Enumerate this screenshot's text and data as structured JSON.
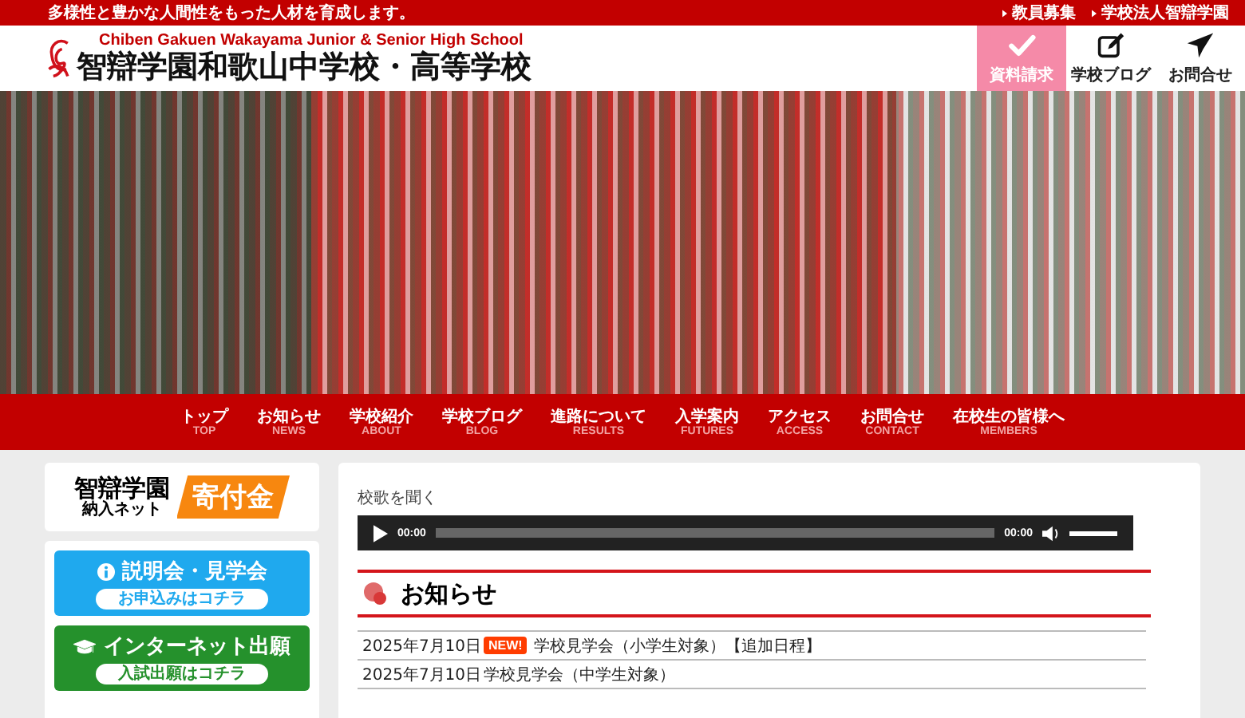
{
  "top_bar": {
    "tagline": "多様性と豊かな人間性をもった人材を育成します。",
    "links": [
      "教員募集",
      "学校法人智辯学園"
    ]
  },
  "header": {
    "school_name_en": "Chiben Gakuen Wakayama Junior & Senior High School",
    "school_name_ja": "智辯学園和歌山中学校・高等学校",
    "buttons": [
      {
        "kind": "check",
        "label": "資料請求",
        "selected": true
      },
      {
        "kind": "pen",
        "label": "学校ブログ",
        "selected": false
      },
      {
        "kind": "plane",
        "label": "お問合せ",
        "selected": false
      }
    ]
  },
  "nav": [
    {
      "label": "トップ",
      "sub": "TOP"
    },
    {
      "label": "お知らせ",
      "sub": "NEWS"
    },
    {
      "label": "学校紹介",
      "sub": "ABOUT"
    },
    {
      "label": "学校ブログ",
      "sub": "BLOG"
    },
    {
      "label": "進路について",
      "sub": "RESULTS"
    },
    {
      "label": "入学案内",
      "sub": "FUTURES"
    },
    {
      "label": "アクセス",
      "sub": "ACCESS"
    },
    {
      "label": "お問合せ",
      "sub": "CONTACT"
    },
    {
      "label": "在校生の皆様へ",
      "sub": "MEMBERS"
    }
  ],
  "sidebar": {
    "donation": {
      "name": "智辯学園",
      "sub": "納入ネット",
      "tag": "寄付金"
    },
    "buttons": [
      {
        "kind": "info",
        "color": "#1fa9ee",
        "label": "説明会・見学会",
        "sub": "お申込みはコチラ"
      },
      {
        "kind": "cap",
        "color": "#25912c",
        "label": "インターネット出願",
        "sub": "入試出願はコチラ"
      }
    ]
  },
  "main": {
    "audio_label": "校歌を聞く",
    "audio": {
      "current": "00:00",
      "duration": "00:00",
      "progress": {
        "level": 0
      },
      "volume": {
        "level": 1
      }
    },
    "news_title": "お知らせ",
    "news": [
      {
        "date": "2025年7月10日",
        "new": true,
        "badge": "NEW!",
        "title": "学校見学会（小学生対象）【追加日程】"
      },
      {
        "date": "2025年7月10日",
        "new": false,
        "title": "学校見学会（中学生対象）"
      }
    ]
  }
}
